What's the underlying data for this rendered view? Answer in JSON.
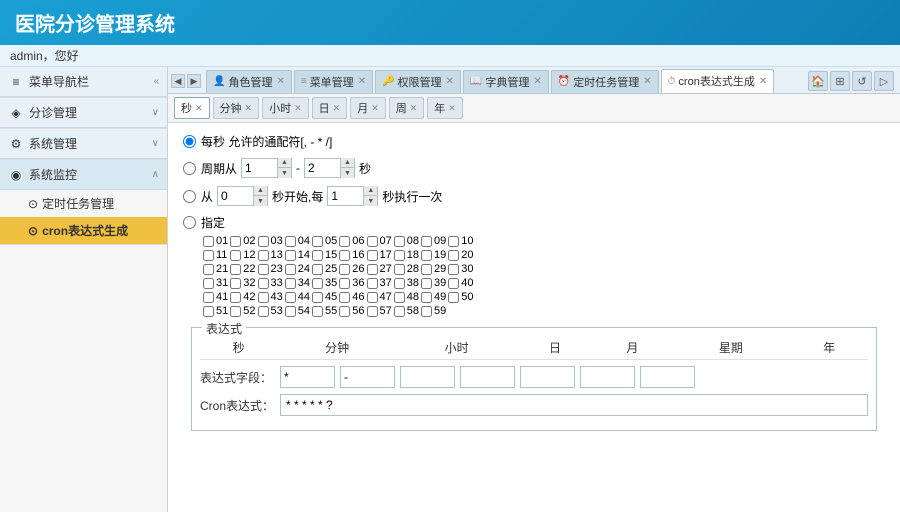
{
  "header": {
    "title_part1": "医院分诊",
    "title_part2": "管理系统"
  },
  "userbar": {
    "text": "admin，您好"
  },
  "sidebar": {
    "sections": [
      {
        "id": "nav",
        "icon": "≡",
        "label": "菜单导航栏",
        "expanded": true,
        "items": []
      },
      {
        "id": "fenzhen",
        "icon": "◈",
        "label": "分诊管理",
        "expanded": false,
        "items": []
      },
      {
        "id": "xitong",
        "icon": "⚙",
        "label": "系统管理",
        "expanded": false,
        "items": []
      },
      {
        "id": "jiankong",
        "icon": "◉",
        "label": "系统监控",
        "expanded": true,
        "active": true,
        "items": [
          {
            "id": "dingshirenwu",
            "label": "定时任务管理"
          },
          {
            "id": "cron",
            "label": "cron表达式生成",
            "active": true
          }
        ]
      }
    ]
  },
  "tabs": {
    "left_arrow": "◀",
    "right_arrow": "▶",
    "items": [
      {
        "id": "jiaose",
        "icon": "👤",
        "label": "角色管理",
        "closable": true
      },
      {
        "id": "caidan",
        "icon": "≡",
        "label": "菜单管理",
        "closable": true
      },
      {
        "id": "quanxian",
        "icon": "🔑",
        "label": "权限管理",
        "closable": true
      },
      {
        "id": "zidian",
        "icon": "📖",
        "label": "字典管理",
        "closable": true
      },
      {
        "id": "dingshi",
        "icon": "⏰",
        "label": "定时任务管理",
        "closable": true
      },
      {
        "id": "crongen",
        "icon": "⏱",
        "label": "cron表达式生成",
        "closable": true,
        "active": true
      }
    ],
    "right_buttons": [
      "🏠",
      "⊞",
      "↺",
      "▷"
    ]
  },
  "time_tabs": {
    "items": [
      {
        "id": "miao",
        "label": "秒",
        "closable": true,
        "active": true
      },
      {
        "id": "fen",
        "label": "分钟",
        "closable": true
      },
      {
        "id": "xiaoshi",
        "label": "小时",
        "closable": true
      },
      {
        "id": "ri",
        "label": "日",
        "closable": true
      },
      {
        "id": "yue",
        "label": "月",
        "closable": true
      },
      {
        "id": "zhou",
        "label": "周",
        "closable": true
      },
      {
        "id": "nian",
        "label": "年",
        "closable": true
      }
    ]
  },
  "cron": {
    "option1_label": "每秒 允许的通配符[, - * /]",
    "option2_label": "周期从",
    "option2_dash": "-",
    "option2_unit": "秒",
    "option2_from": "1",
    "option2_to": "2",
    "option3_label": "从",
    "option3_unit1": "秒开始,每",
    "option3_unit2": "秒执行一次",
    "option3_val1": "0",
    "option3_val2": "1",
    "option4_label": "指定",
    "checkboxes": [
      "01",
      "02",
      "03",
      "04",
      "05",
      "06",
      "07",
      "08",
      "09",
      "10",
      "11",
      "12",
      "13",
      "14",
      "15",
      "16",
      "17",
      "18",
      "19",
      "20",
      "21",
      "22",
      "23",
      "24",
      "25",
      "26",
      "27",
      "28",
      "29",
      "30",
      "31",
      "32",
      "33",
      "34",
      "35",
      "36",
      "37",
      "38",
      "39",
      "40",
      "41",
      "42",
      "43",
      "44",
      "45",
      "46",
      "47",
      "48",
      "49",
      "50",
      "51",
      "52",
      "53",
      "54",
      "55",
      "56",
      "57",
      "58",
      "59"
    ],
    "expression_legend": "表达式",
    "expr_headers": [
      "秒",
      "分钟",
      "小时",
      "日",
      "月",
      "星期",
      "年"
    ],
    "expr_row_label": "表达式字段：",
    "expr_values": [
      "*",
      "-",
      "",
      "",
      "",
      "",
      ""
    ],
    "cron_row_label": "Cron表达式：",
    "cron_value": "* * * * * ?"
  }
}
